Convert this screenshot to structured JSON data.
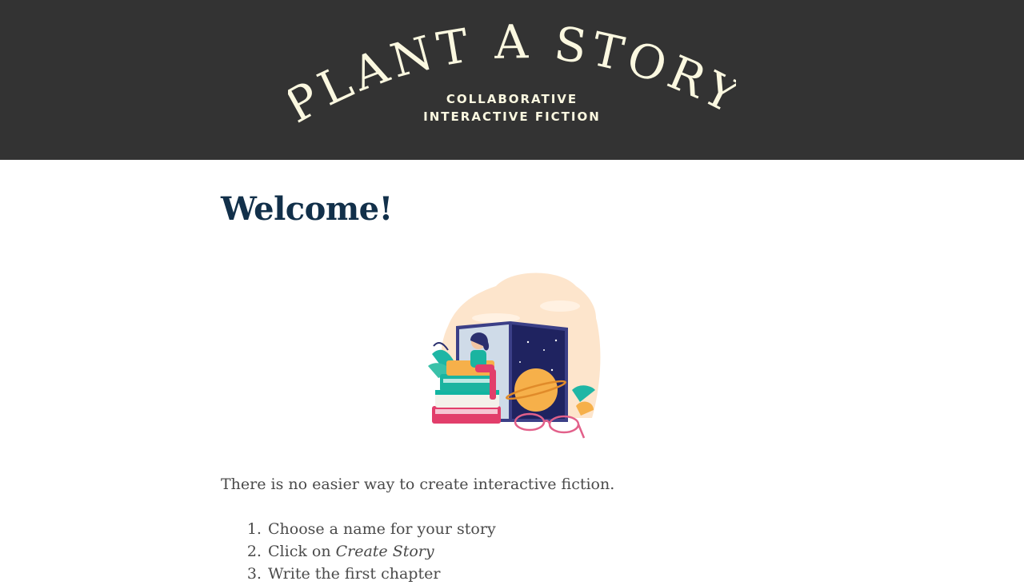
{
  "header": {
    "logo_text": "PLANT A STORY",
    "subtitle_line1": "COLLABORATIVE",
    "subtitle_line2": "INTERACTIVE FICTION"
  },
  "main": {
    "title": "Welcome!",
    "illustration_icon": "reading-books-illustration",
    "intro": "There is no easier way to create interactive fiction.",
    "steps": [
      {
        "prefix": "Choose a name for your story",
        "emphasis": ""
      },
      {
        "prefix": "Click on ",
        "emphasis": "Create Story"
      },
      {
        "prefix": "Write the first chapter",
        "emphasis": ""
      }
    ]
  },
  "colors": {
    "header_bg": "#333333",
    "logo_text": "#fbf8e0",
    "title": "#12304a",
    "body_text": "#4a4a4a"
  }
}
